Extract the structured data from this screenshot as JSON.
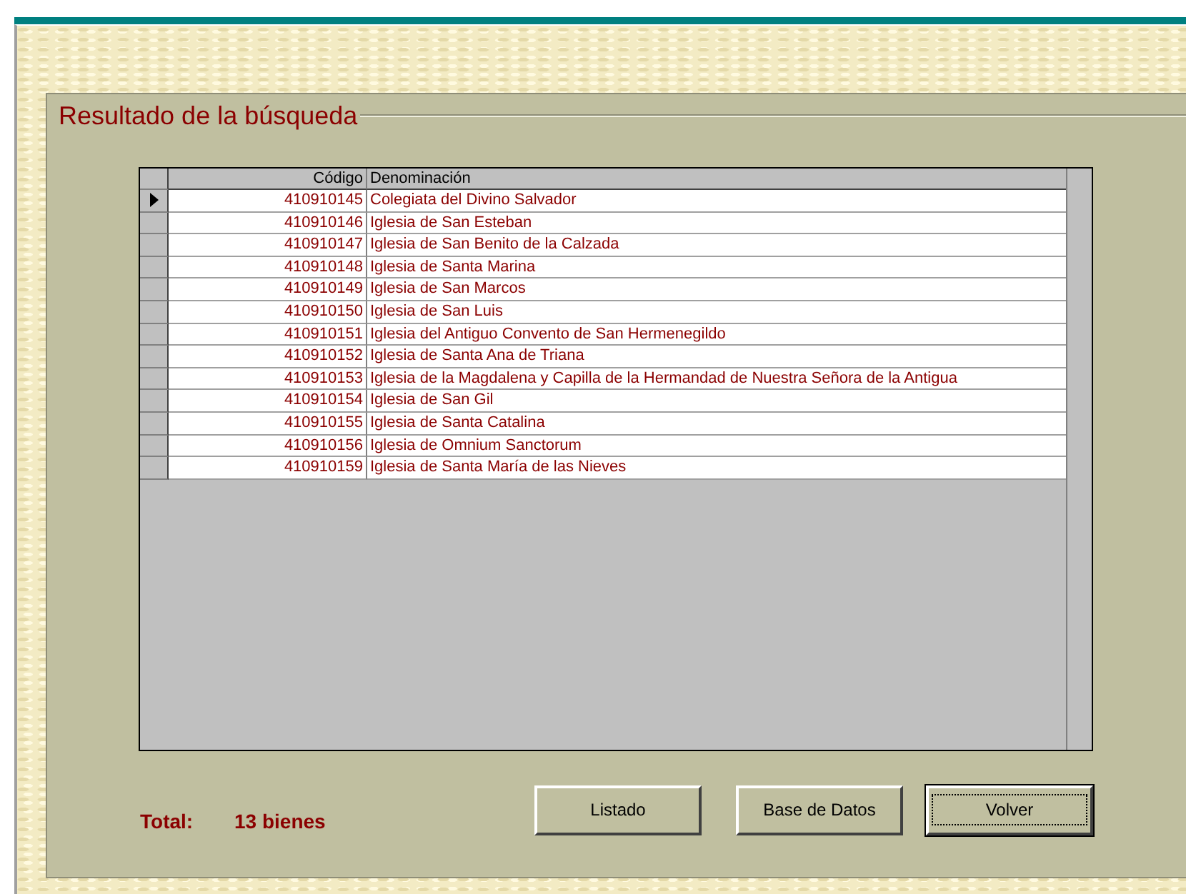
{
  "panel": {
    "title": "Resultado de la búsqueda"
  },
  "grid": {
    "columns": [
      "Código",
      "Denominación"
    ],
    "rows": [
      {
        "code": "410910145",
        "name": "Colegiata del Divino Salvador",
        "selected": true
      },
      {
        "code": "410910146",
        "name": "Iglesia de San Esteban",
        "selected": false
      },
      {
        "code": "410910147",
        "name": "Iglesia de San Benito de la Calzada",
        "selected": false
      },
      {
        "code": "410910148",
        "name": "Iglesia de Santa Marina",
        "selected": false
      },
      {
        "code": "410910149",
        "name": "Iglesia de San Marcos",
        "selected": false
      },
      {
        "code": "410910150",
        "name": "Iglesia de San Luis",
        "selected": false
      },
      {
        "code": "410910151",
        "name": "Iglesia del Antiguo Convento de San Hermenegildo",
        "selected": false
      },
      {
        "code": "410910152",
        "name": "Iglesia de Santa Ana de Triana",
        "selected": false
      },
      {
        "code": "410910153",
        "name": "Iglesia de la Magdalena y Capilla de la Hermandad de Nuestra Señora de la Antigua",
        "selected": false
      },
      {
        "code": "410910154",
        "name": "Iglesia de San Gil",
        "selected": false
      },
      {
        "code": "410910155",
        "name": "Iglesia de Santa Catalina",
        "selected": false
      },
      {
        "code": "410910156",
        "name": "Iglesia de Omnium Sanctorum",
        "selected": false
      },
      {
        "code": "410910159",
        "name": "Iglesia de Santa María de las Nieves",
        "selected": false
      }
    ]
  },
  "total": {
    "label": "Total:",
    "value": "13 bienes"
  },
  "buttons": [
    {
      "label": "Listado",
      "focused": false
    },
    {
      "label": "Base de Datos",
      "focused": false
    },
    {
      "label": "Volver",
      "focused": true
    }
  ]
}
